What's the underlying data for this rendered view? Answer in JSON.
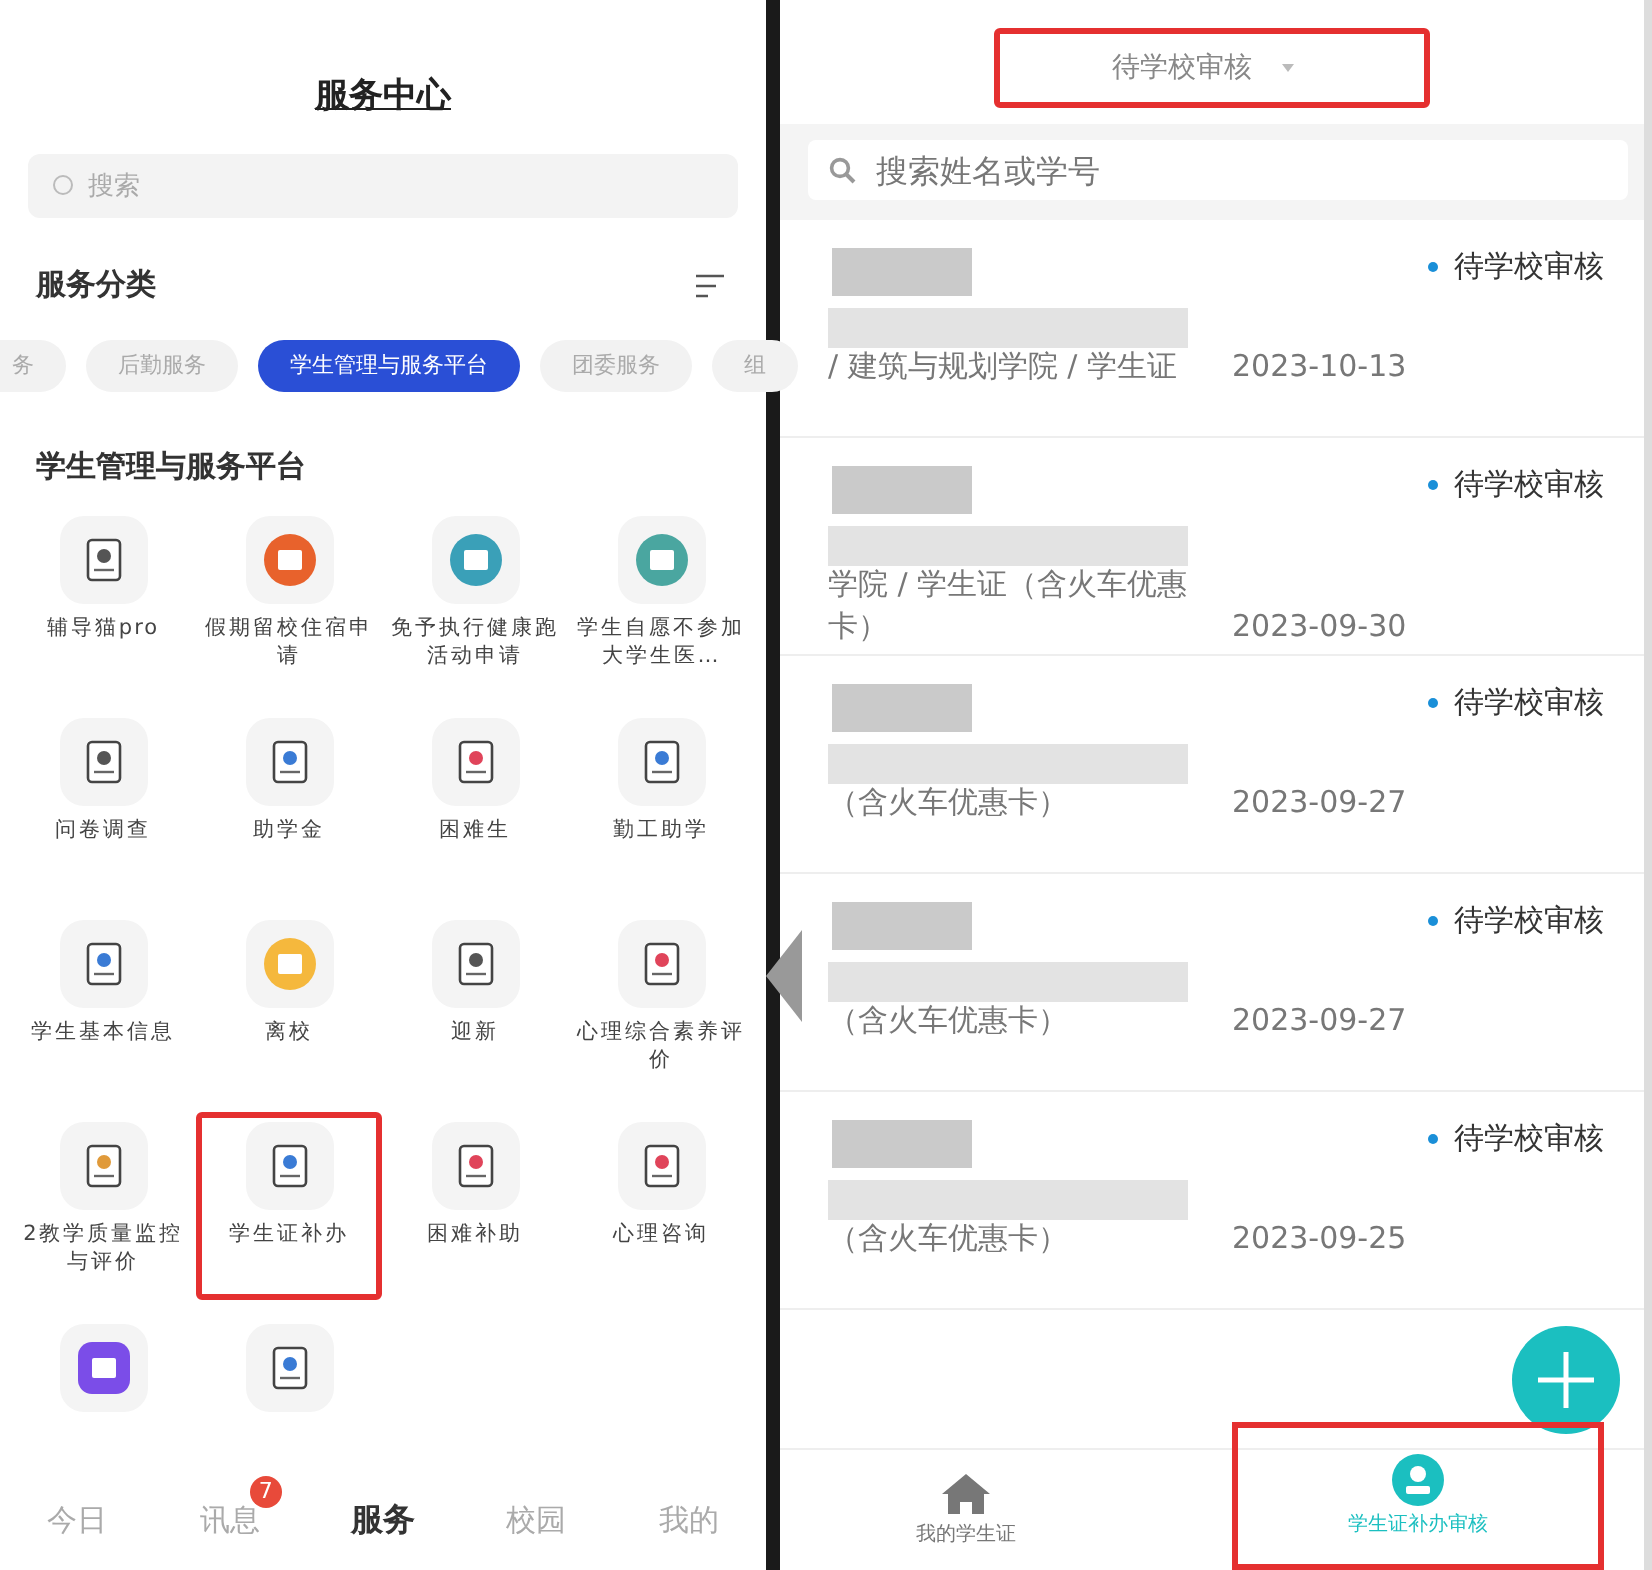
{
  "left": {
    "title": "服务中心",
    "search": {
      "placeholder": "搜索"
    },
    "category_heading": "服务分类",
    "chips": [
      {
        "label": "务",
        "selected": false
      },
      {
        "label": "后勤服务",
        "selected": false
      },
      {
        "label": "学生管理与服务平台",
        "selected": true
      },
      {
        "label": "团委服务",
        "selected": false
      },
      {
        "label": "组",
        "selected": false
      }
    ],
    "section_heading": "学生管理与服务平台",
    "apps": [
      {
        "label": "辅导猫pro",
        "highlighted": false
      },
      {
        "label": "假期留校住宿申请",
        "highlighted": false
      },
      {
        "label": "免予执行健康跑活动申请",
        "highlighted": false
      },
      {
        "label": "学生自愿不参加大学生医…",
        "highlighted": false
      },
      {
        "label": "问卷调查",
        "highlighted": false
      },
      {
        "label": "助学金",
        "highlighted": false
      },
      {
        "label": "困难生",
        "highlighted": false
      },
      {
        "label": "勤工助学",
        "highlighted": false
      },
      {
        "label": "学生基本信息",
        "highlighted": false
      },
      {
        "label": "离校",
        "highlighted": false
      },
      {
        "label": "迎新",
        "highlighted": false
      },
      {
        "label": "心理综合素养评价",
        "highlighted": false
      },
      {
        "label": "2教学质量监控与评价",
        "highlighted": false
      },
      {
        "label": "学生证补办",
        "highlighted": true
      },
      {
        "label": "困难补助",
        "highlighted": false
      },
      {
        "label": "心理咨询",
        "highlighted": false
      },
      {
        "highlighted": false
      },
      {
        "highlighted": false
      }
    ],
    "nav": [
      {
        "label": "今日",
        "selected": false
      },
      {
        "label": "讯息",
        "selected": false,
        "badge": "7"
      },
      {
        "label": "服务",
        "selected": true
      },
      {
        "label": "校园",
        "selected": false
      },
      {
        "label": "我的",
        "selected": false
      }
    ]
  },
  "right": {
    "filter": {
      "label": "待学校审核",
      "highlighted": true
    },
    "search": {
      "placeholder": "搜索姓名或学号"
    },
    "records": [
      {
        "detail": "/ 建筑与规划学院 / 学生证",
        "date": "2023-10-13",
        "status": "待学校审核",
        "color": "#1a8fd8"
      },
      {
        "detail": "学院 / 学生证（含火车优惠卡）",
        "date": "2023-09-30",
        "status": "待学校审核",
        "color": "#1a8fd8"
      },
      {
        "detail": "（含火车优惠卡）",
        "date": "2023-09-27",
        "status": "待学校审核",
        "color": "#1a8fd8"
      },
      {
        "detail": "（含火车优惠卡）",
        "date": "2023-09-27",
        "status": "待学校审核",
        "color": "#1a8fd8"
      },
      {
        "detail": "（含火车优惠卡）",
        "date": "2023-09-25",
        "status": "待学校审核",
        "color": "#1a8fd8"
      }
    ],
    "tabs": [
      {
        "label": "我的学生证",
        "selected": false,
        "highlighted": false
      },
      {
        "label": "学生证补办审核",
        "selected": true,
        "highlighted": true
      }
    ]
  }
}
